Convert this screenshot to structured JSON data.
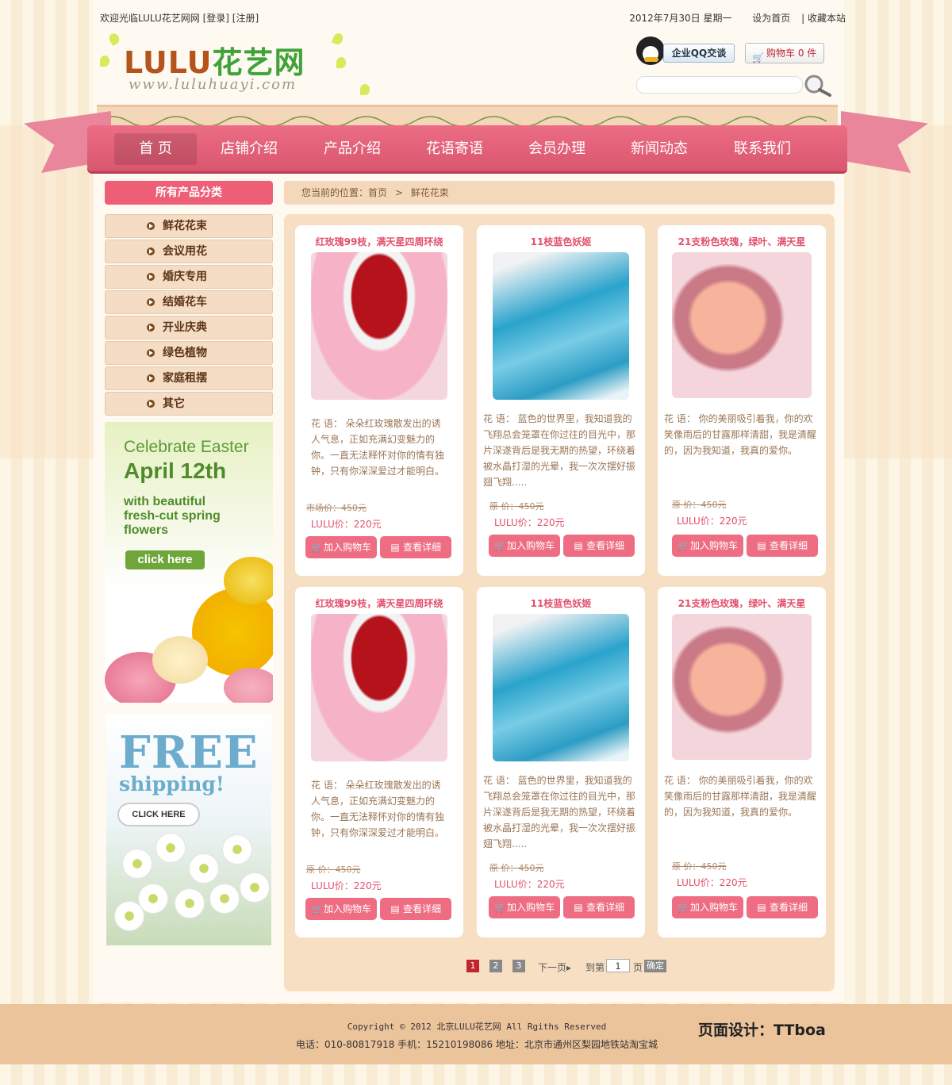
{
  "topbar": {
    "welcome": "欢迎光临LULU花艺网网",
    "login": "[登录]",
    "register": "[注册]",
    "date": "2012年7月30日 星期一",
    "set_home": "设为首页",
    "bookmark": "| 收藏本站"
  },
  "logo": {
    "main": "LULU",
    "main_cn": "花艺网",
    "url": "www.luluhuayi.com"
  },
  "header": {
    "qq_label": "企业QQ交谈",
    "cart_label": "购物车 0 件",
    "search_placeholder": ""
  },
  "nav": {
    "items": [
      {
        "label": "首  页"
      },
      {
        "label": "店铺介绍"
      },
      {
        "label": "产品介绍"
      },
      {
        "label": "花语寄语"
      },
      {
        "label": "会员办理"
      },
      {
        "label": "新闻动态"
      },
      {
        "label": "联系我们"
      }
    ]
  },
  "sidebar": {
    "heading": "所有产品分类",
    "categories": [
      {
        "label": "鲜花花束"
      },
      {
        "label": "会议用花"
      },
      {
        "label": "婚庆专用"
      },
      {
        "label": "结婚花车"
      },
      {
        "label": "开业庆典"
      },
      {
        "label": "绿色植物"
      },
      {
        "label": "家庭租摆"
      },
      {
        "label": "其它"
      }
    ],
    "banner1": {
      "line1": "Celebrate Easter",
      "line2": "April 12th",
      "line3": "with beautiful fresh-cut spring flowers",
      "cta": "click here"
    },
    "banner2": {
      "line1": "FREE",
      "line2": "shipping!",
      "cta": "CLICK HERE"
    }
  },
  "breadcrumb": {
    "prefix": "您当前的位置：首页",
    "sep": ">",
    "current": "鲜花花束"
  },
  "products": [
    {
      "title": "红玫瑰99枝，满天星四周环绕",
      "desc": "花  语： 朵朵红玫瑰散发出的诱人气息，正如充满幻变魅力的你。一直无法释怀对你的情有独钟，只有你深深爱过才能明白。",
      "old_price": "市场价：450元",
      "price": "LULU价：220元",
      "add_cart": "加入购物车",
      "detail": "查看详细",
      "image": "red-roses"
    },
    {
      "title": "11枝蓝色妖姬",
      "desc": "花  语： 蓝色的世界里，我知道我的飞翔总会笼罩在你过往的目光中，那片深遂背后是我无期的热望，环绕着被水晶打湿的光晕，我一次次摆好振翅飞翔.....",
      "old_price": "原  价：450元",
      "price": "LULU价：220元",
      "add_cart": "加入购物车",
      "detail": "查看详细",
      "image": "blue-roses"
    },
    {
      "title": "21支粉色玫瑰，绿叶、满天星",
      "desc": "花  语： 你的美丽吸引着我，你的欢笑像雨后的甘露那样清甜，我是清醒的，因为我知道，我真的爱你。",
      "old_price": "原  价：450元",
      "price": "LULU价：220元",
      "add_cart": "加入购物车",
      "detail": "查看详细",
      "image": "pink-roses"
    },
    {
      "title": "红玫瑰99枝，满天星四周环绕",
      "desc": "花  语： 朵朵红玫瑰散发出的诱人气息，正如充满幻变魅力的你。一直无法释怀对你的情有独钟，只有你深深爱过才能明白。",
      "old_price": "原  价：450元",
      "price": "LULU价：220元",
      "add_cart": "加入购物车",
      "detail": "查看详细",
      "image": "red-roses"
    },
    {
      "title": "11枝蓝色妖姬",
      "desc": "花  语： 蓝色的世界里，我知道我的飞翔总会笼罩在你过往的目光中，那片深遂背后是我无期的热望，环绕着被水晶打湿的光晕，我一次次摆好振翅飞翔.....",
      "old_price": "原  价：450元",
      "price": "LULU价：220元",
      "add_cart": "加入购物车",
      "detail": "查看详细",
      "image": "blue-roses"
    },
    {
      "title": "21支粉色玫瑰，绿叶、满天星",
      "desc": "花  语： 你的美丽吸引着我，你的欢笑像雨后的甘露那样清甜，我是清醒的，因为我知道，我真的爱你。",
      "old_price": "原  价：450元",
      "price": "LULU价：220元",
      "add_cart": "加入购物车",
      "detail": "查看详细",
      "image": "pink-roses"
    }
  ],
  "pager": {
    "pages": [
      "1",
      "2",
      "3"
    ],
    "current": "1",
    "next": "下一页",
    "goto_prefix": "到第",
    "goto_value": "1",
    "goto_suffix": "页",
    "confirm": "确定"
  },
  "footer": {
    "copyright": "Copyright © 2012 北京LULU花艺网 All Rgiths Reserved",
    "contact": "电话：010-80817918   手机：15210198086   地址：北京市通州区梨园地铁站淘宝城",
    "designer": "页面设计：TTboa"
  },
  "colors": {
    "accent": "#ee5f77",
    "nav": "#e0607a",
    "brown": "#5b3416",
    "footer": "#ecc49c"
  }
}
